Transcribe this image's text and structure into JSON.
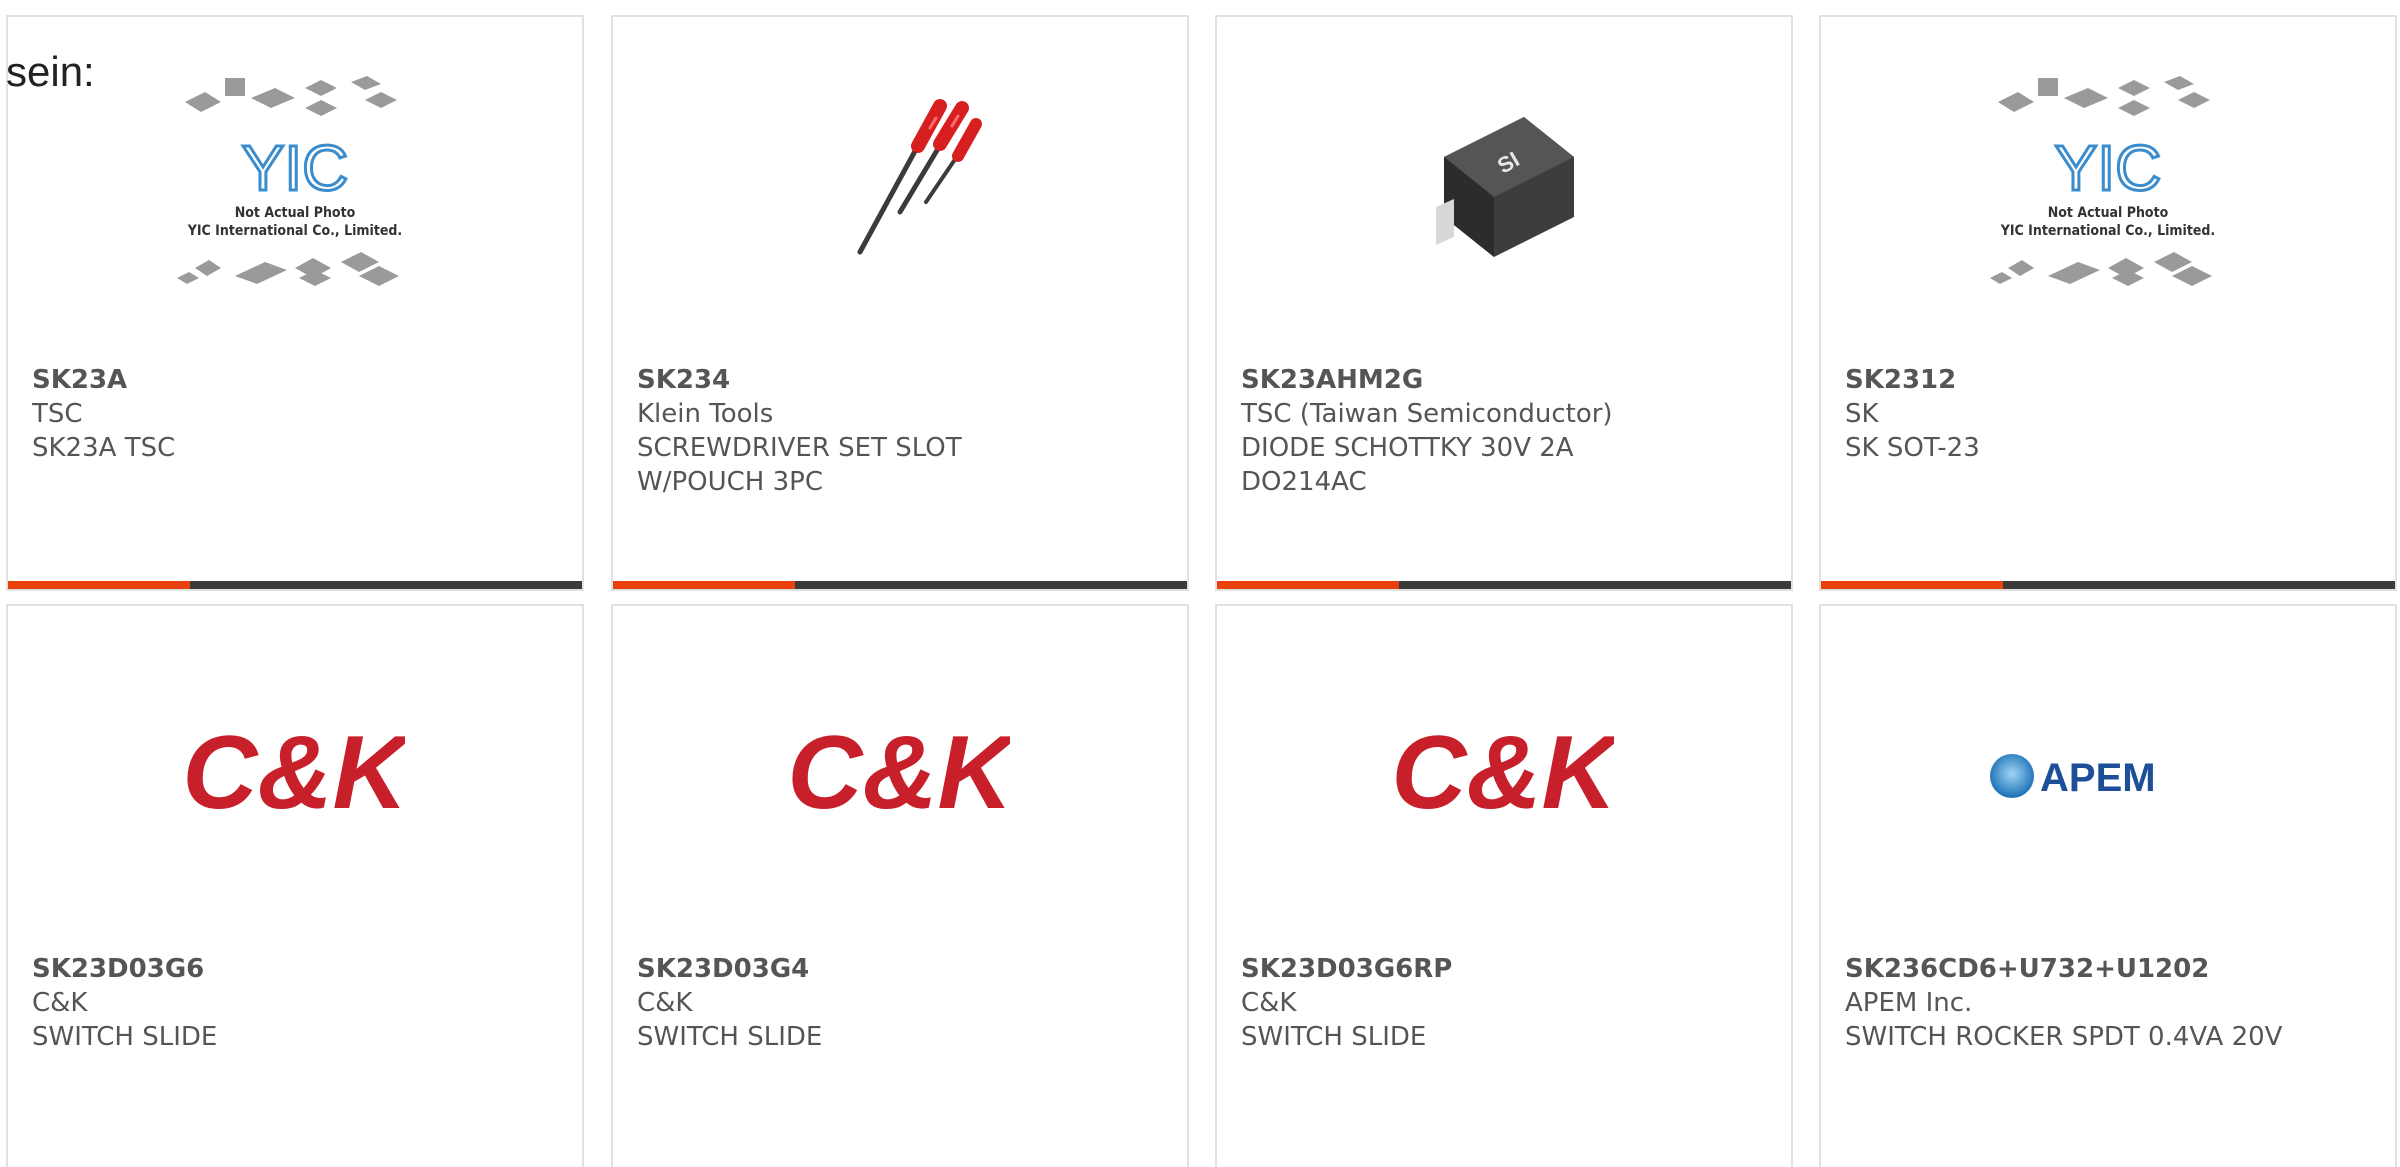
{
  "page_label": "sein:",
  "colors": {
    "accent_bar": "#e8410d",
    "dark_bar": "#3a3a3a",
    "text": "#555555",
    "card_border": "#e1e1e1"
  },
  "placeholder": {
    "brand_text": "YIC",
    "line1": "Not Actual Photo",
    "line2": "YIC International Co., Limited."
  },
  "products": [
    {
      "part_number": "SK23A",
      "manufacturer": "TSC",
      "description": "SK23A TSC",
      "image": "placeholder-photo"
    },
    {
      "part_number": "SK234",
      "manufacturer": "Klein Tools",
      "description": "SCREWDRIVER SET SLOT W/POUCH 3PC",
      "image": "screwdriver-set-photo"
    },
    {
      "part_number": "SK23AHM2G",
      "manufacturer": "TSC (Taiwan Semiconductor)",
      "description": "DIODE SCHOTTKY 30V 2A DO214AC",
      "image": "diode-smd-photo"
    },
    {
      "part_number": "SK2312",
      "manufacturer": "SK",
      "description": "SK SOT-23",
      "image": "placeholder-photo"
    },
    {
      "part_number": "SK23D03G6",
      "manufacturer": "C&K",
      "description": "SWITCH SLIDE",
      "image": "ck-logo",
      "logo_text": "C&K"
    },
    {
      "part_number": "SK23D03G4",
      "manufacturer": "C&K",
      "description": "SWITCH SLIDE",
      "image": "ck-logo",
      "logo_text": "C&K"
    },
    {
      "part_number": "SK23D03G6RP",
      "manufacturer": "C&K",
      "description": "SWITCH SLIDE",
      "image": "ck-logo",
      "logo_text": "C&K"
    },
    {
      "part_number": "SK236CD6+U732+U1202",
      "manufacturer": "APEM Inc.",
      "description": "SWITCH ROCKER SPDT 0.4VA 20V",
      "image": "apem-logo",
      "logo_text": "APEM"
    }
  ]
}
